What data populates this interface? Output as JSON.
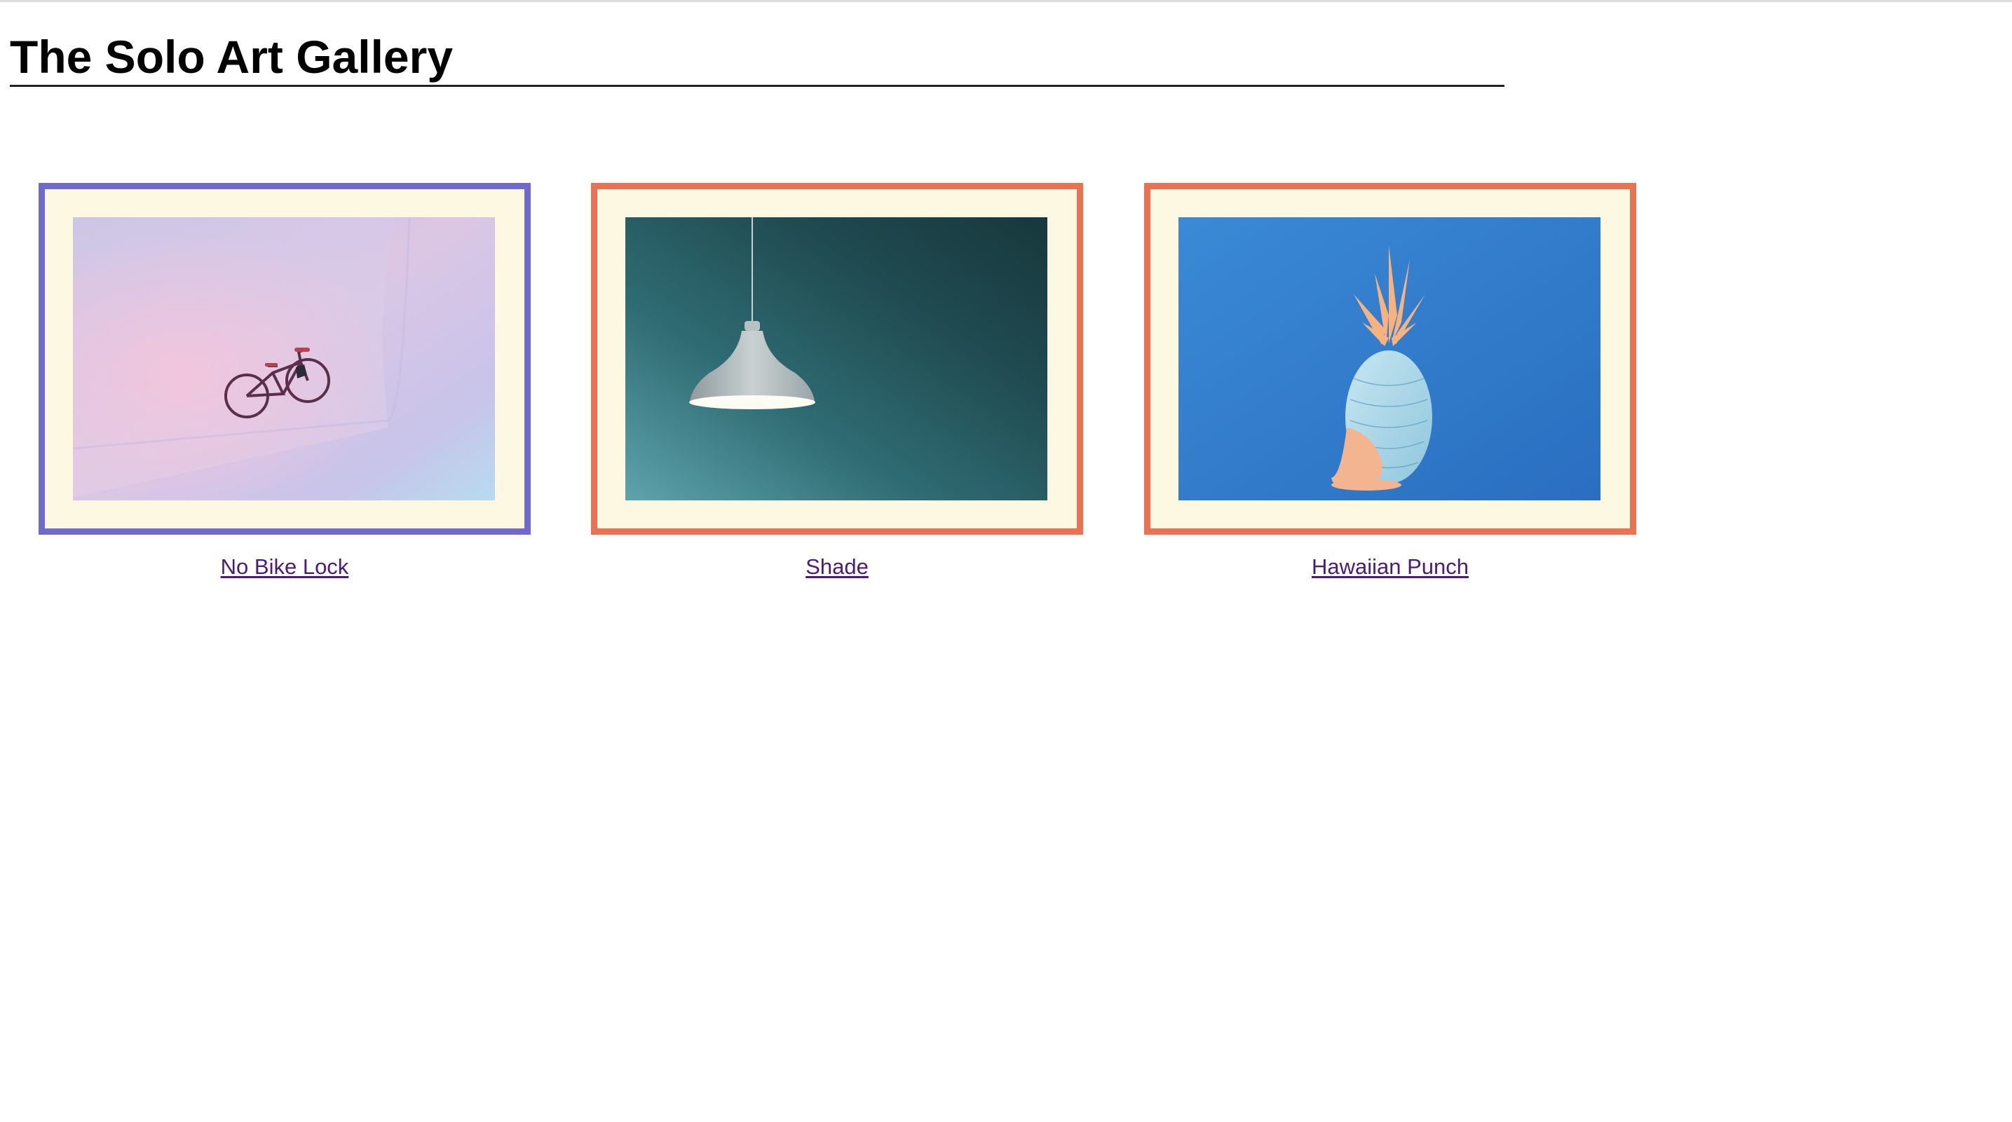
{
  "page": {
    "title": "The Solo Art Gallery"
  },
  "gallery": {
    "items": [
      {
        "title": "No Bike Lock",
        "frame_color": "#6f6acb",
        "image": "bicycle-photo"
      },
      {
        "title": "Shade",
        "frame_color": "#e97253",
        "image": "pendant-lamp-photo"
      },
      {
        "title": "Hawaiian Punch",
        "frame_color": "#e97253",
        "image": "pineapple-photo"
      }
    ]
  },
  "colors": {
    "mat": "#fdf8e1",
    "link": "#4a1a7e",
    "frame_purple": "#6f6acb",
    "frame_orange": "#e97253"
  }
}
